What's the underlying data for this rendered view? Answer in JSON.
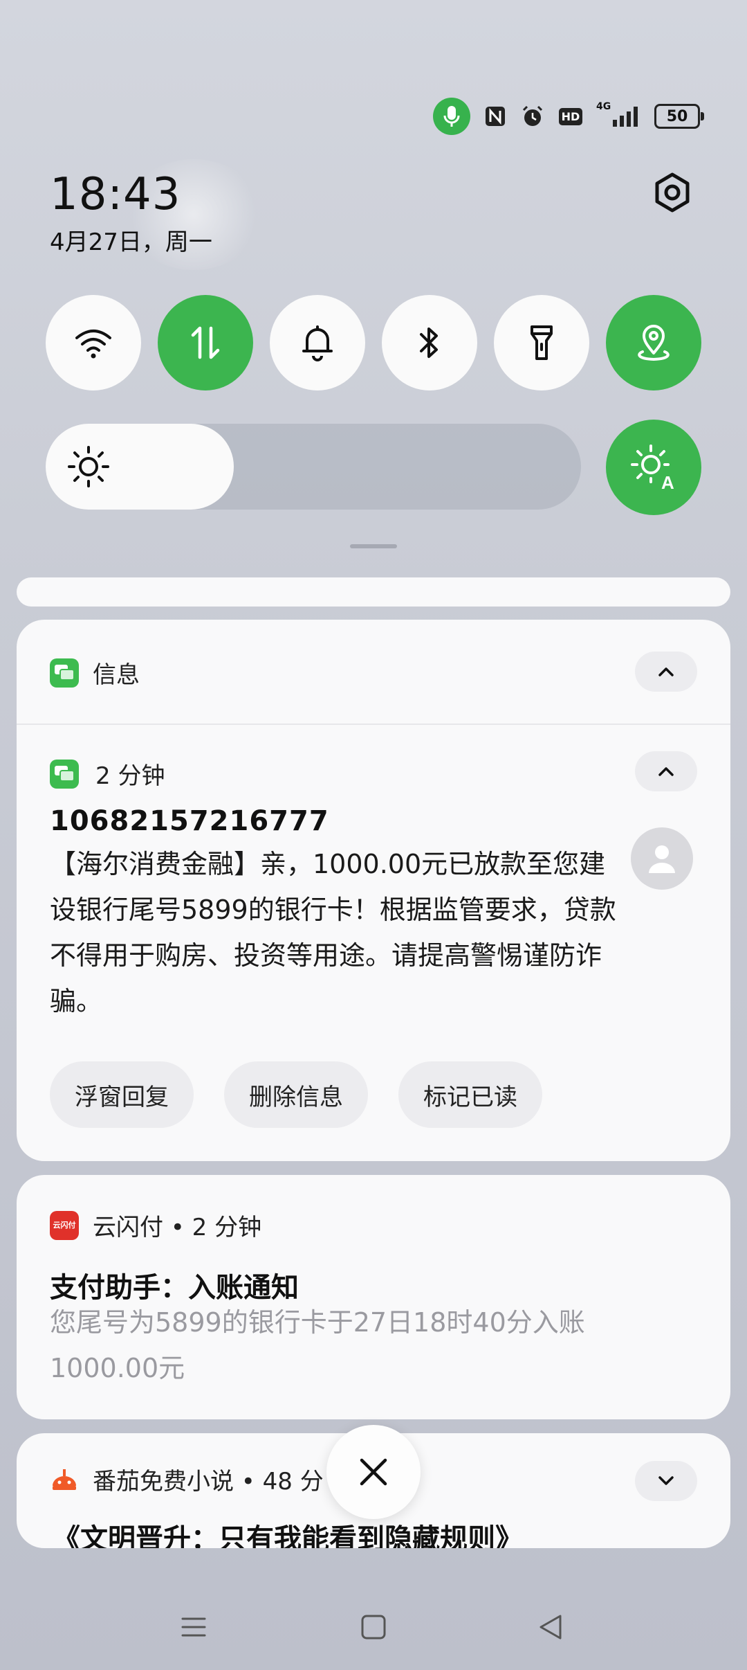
{
  "status_bar": {
    "icons": [
      "mic-icon",
      "nfc-icon",
      "alarm-icon",
      "hd-icon",
      "signal-4g-icon"
    ],
    "hd_text": "HD",
    "network_text": "4G",
    "battery": "50"
  },
  "header": {
    "time": "18:43",
    "date": "4月27日，周一"
  },
  "quick_toggles": [
    {
      "name": "wifi",
      "icon": "wifi-icon",
      "on": false
    },
    {
      "name": "mobile-data",
      "icon": "data-arrows-icon",
      "on": true
    },
    {
      "name": "sound",
      "icon": "bell-icon",
      "on": false
    },
    {
      "name": "bluetooth",
      "icon": "bluetooth-icon",
      "on": false
    },
    {
      "name": "flashlight",
      "icon": "flashlight-icon",
      "on": false
    },
    {
      "name": "location",
      "icon": "location-icon",
      "on": true
    }
  ],
  "brightness": {
    "level": 0.3,
    "auto_on": true
  },
  "messages_card": {
    "app_name": "信息",
    "time": "2 分钟",
    "sender": "10682157216777",
    "body": "【海尔消费金融】亲，1000.00元已放款至您建设银行尾号5899的银行卡！根据监管要求，贷款不得用于购房、投资等用途。请提高警惕谨防诈骗。",
    "actions": [
      "浮窗回复",
      "删除信息",
      "标记已读"
    ]
  },
  "yunshanfu_card": {
    "app_line": "云闪付 • 2 分钟",
    "icon_text": "云闪付",
    "title": "支付助手：入账通知",
    "body": "您尾号为5899的银行卡于27日18时40分入账1000.00元"
  },
  "fanqie_card": {
    "app_line": "番茄免费小说 • 48 分",
    "title": "《文明晋升：只有我能看到隐藏规则》"
  },
  "colors": {
    "accent": "#3cb54f",
    "card": "#f9f9fa",
    "muted_text": "#9a9aa0"
  }
}
